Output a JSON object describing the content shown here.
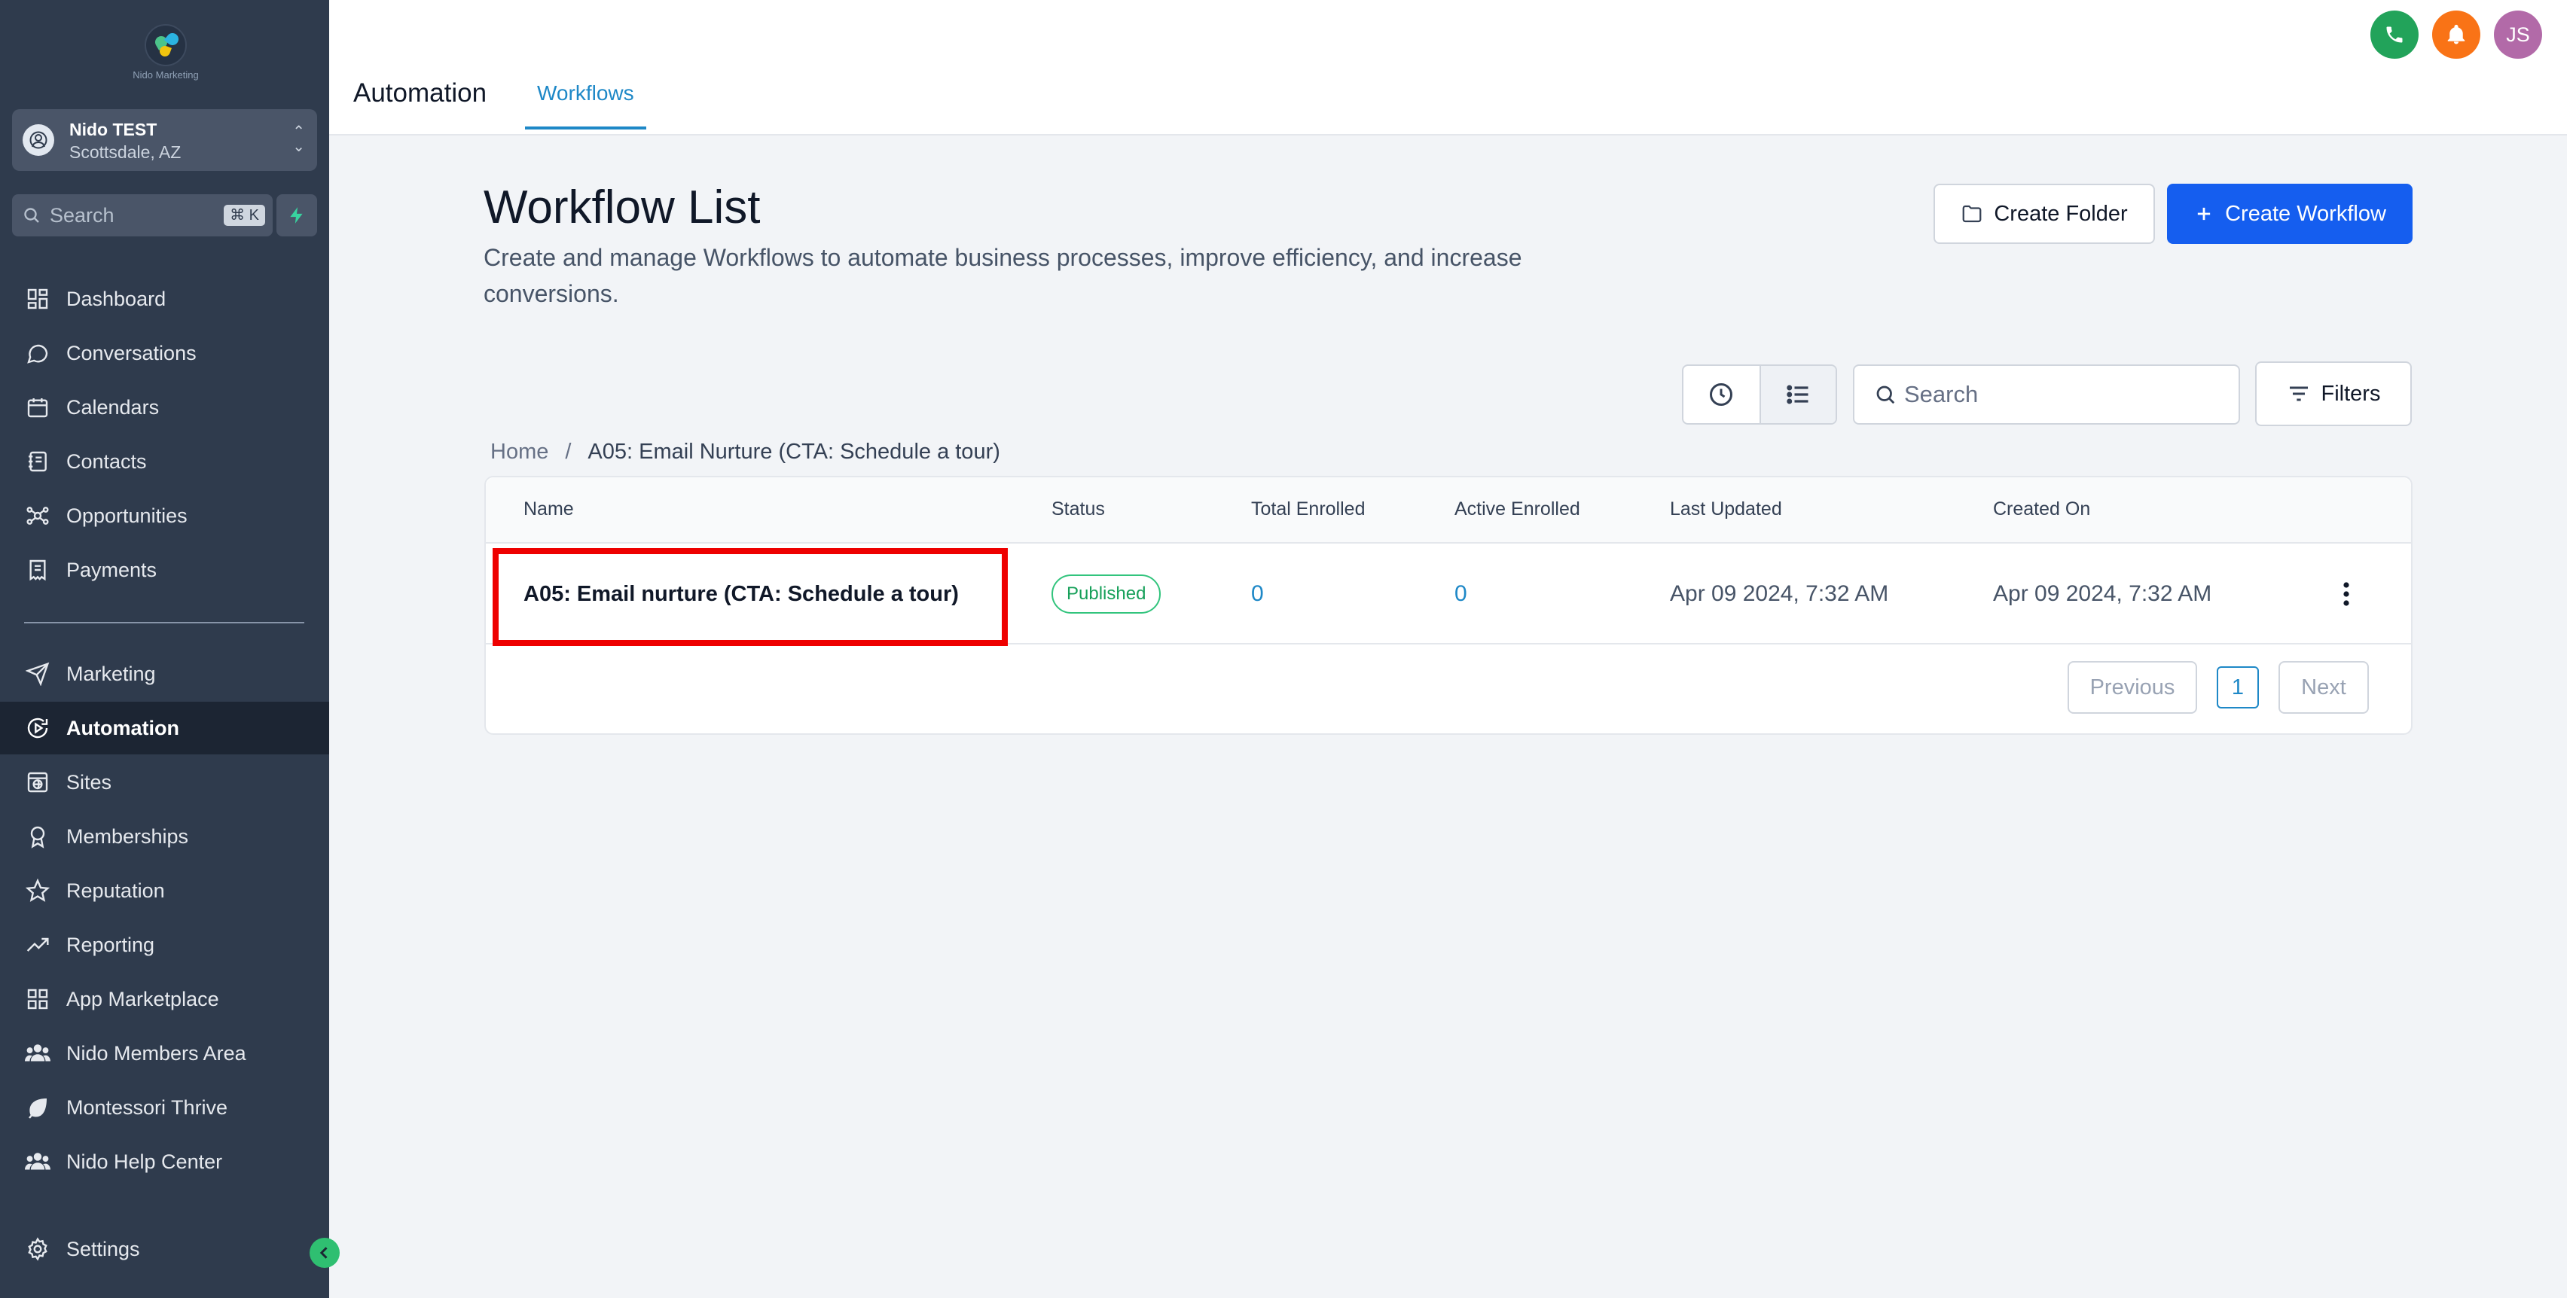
{
  "sidebar": {
    "logo_caption": "Nido Marketing",
    "location": {
      "name": "Nido TEST",
      "address": "Scottsdale, AZ"
    },
    "search": {
      "placeholder": "Search",
      "shortcut": "⌘ K"
    },
    "items": [
      {
        "label": "Dashboard",
        "icon": "dashboard-icon"
      },
      {
        "label": "Conversations",
        "icon": "chat-icon"
      },
      {
        "label": "Calendars",
        "icon": "calendar-icon"
      },
      {
        "label": "Contacts",
        "icon": "contacts-icon"
      },
      {
        "label": "Opportunities",
        "icon": "opportunities-icon"
      },
      {
        "label": "Payments",
        "icon": "payments-icon"
      },
      {
        "label": "Marketing",
        "icon": "send-icon"
      },
      {
        "label": "Automation",
        "icon": "automation-icon",
        "active": true
      },
      {
        "label": "Sites",
        "icon": "sites-icon"
      },
      {
        "label": "Memberships",
        "icon": "award-icon"
      },
      {
        "label": "Reputation",
        "icon": "star-icon"
      },
      {
        "label": "Reporting",
        "icon": "trend-icon"
      },
      {
        "label": "App Marketplace",
        "icon": "grid-icon"
      },
      {
        "label": "Nido Members Area",
        "icon": "users-icon"
      },
      {
        "label": "Montessori Thrive",
        "icon": "leaf-icon"
      },
      {
        "label": "Nido Help Center",
        "icon": "users-icon"
      }
    ],
    "settings_label": "Settings"
  },
  "topbar": {
    "title": "Automation",
    "tab": "Workflows",
    "user_initials": "JS"
  },
  "main": {
    "title": "Workflow List",
    "description": "Create and manage Workflows to automate business processes, improve efficiency, and increase conversions.",
    "create_folder_label": "Create Folder",
    "create_workflow_label": "Create Workflow",
    "search_placeholder": "Search",
    "filters_label": "Filters",
    "breadcrumb": {
      "home": "Home",
      "separator": "/",
      "current": "A05: Email Nurture (CTA: Schedule a tour)"
    }
  },
  "table": {
    "columns": [
      "Name",
      "Status",
      "Total Enrolled",
      "Active Enrolled",
      "Last Updated",
      "Created On"
    ],
    "rows": [
      {
        "name": "A05: Email nurture (CTA: Schedule a tour)",
        "status": "Published",
        "total_enrolled": "0",
        "active_enrolled": "0",
        "last_updated": "Apr 09 2024, 7:32 AM",
        "created_on": "Apr 09 2024, 7:32 AM"
      }
    ],
    "pagination": {
      "previous": "Previous",
      "page": "1",
      "next": "Next"
    }
  },
  "colors": {
    "sidebar_bg": "#2f3b4d",
    "primary": "#155eef",
    "accent_link": "#1e88c7",
    "published": "#17a05a",
    "highlight": "#ee0000"
  }
}
